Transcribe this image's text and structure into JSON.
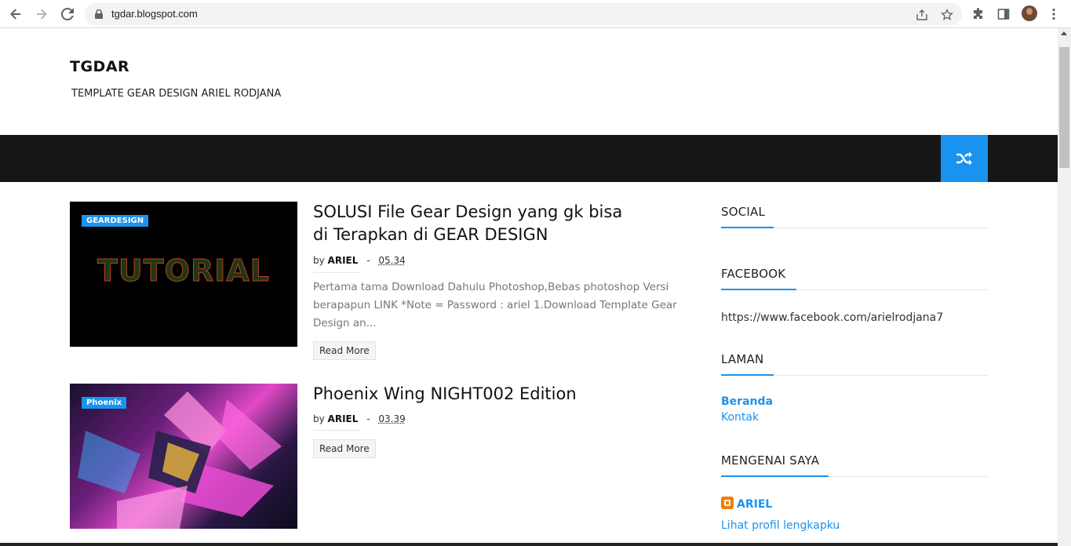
{
  "browser": {
    "url": "tgdar.blogspot.com",
    "back_icon": "arrow-left-icon",
    "forward_icon": "arrow-right-icon",
    "reload_icon": "reload-icon"
  },
  "site": {
    "title": "TGDAR",
    "description": "TEMPLATE GEAR DESIGN ARIEL RODJANA"
  },
  "navbar": {
    "shuffle_icon": "shuffle-icon",
    "accent_color": "#1a93f0"
  },
  "posts": [
    {
      "label": "GEARDESIGN",
      "thumb_text": "TUTORIAL",
      "title": "SOLUSI File Gear Design yang gk bisa di Terapkan di GEAR DESIGN",
      "by": "by",
      "author": "ARIEL",
      "dash": "-",
      "time": "05.34",
      "snippet": "Pertama tama Download Dahulu Photoshop,Bebas photoshop Versi berapapun LINK *Note = Password : ariel 1.Download Template Gear Design an...",
      "read_more": "Read More"
    },
    {
      "label": "Phoenix",
      "title": "Phoenix Wing NIGHT002 Edition",
      "by": "by",
      "author": "ARIEL",
      "dash": "-",
      "time": "03.39",
      "read_more": "Read More"
    }
  ],
  "sidebar": {
    "social": {
      "title": "SOCIAL"
    },
    "facebook": {
      "title": "FACEBOOK",
      "text": "https://www.facebook.com/arielrodjana7"
    },
    "laman": {
      "title": "LAMAN",
      "links": [
        "Beranda",
        "Kontak"
      ]
    },
    "about": {
      "title": "MENGENAI SAYA",
      "name": "ARIEL",
      "profile_link": "Lihat profil lengkapku"
    }
  }
}
